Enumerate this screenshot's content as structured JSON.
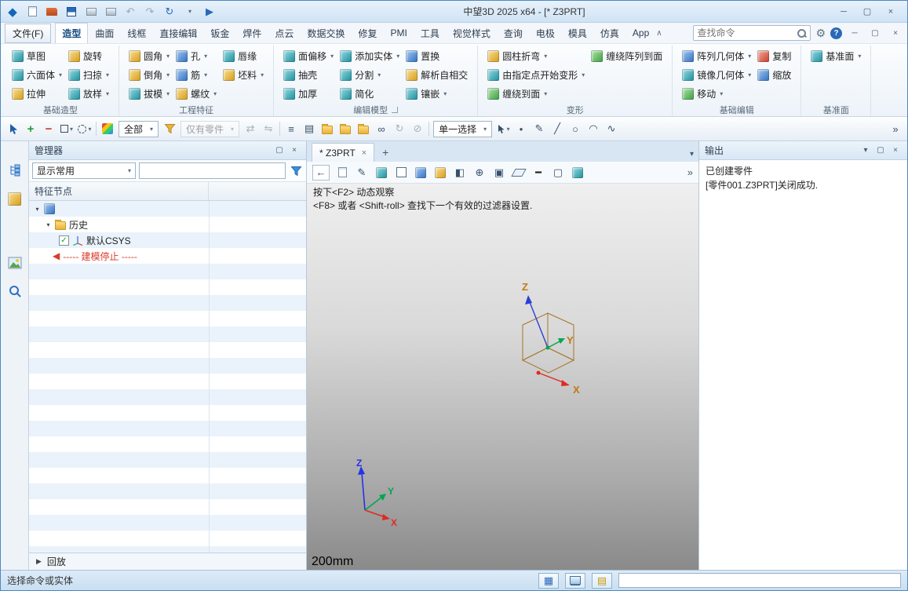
{
  "titlebar": {
    "title": "中望3D 2025 x64 - [* Z3PRT]"
  },
  "menubar": {
    "file_menu": "文件(F)",
    "tabs": [
      "造型",
      "曲面",
      "线框",
      "直接编辑",
      "钣金",
      "焊件",
      "点云",
      "数据交换",
      "修复",
      "PMI",
      "工具",
      "视觉样式",
      "查询",
      "电极",
      "模具",
      "仿真",
      "App"
    ],
    "active_tab": "造型",
    "search_placeholder": "查找命令"
  },
  "ribbon": {
    "groups": [
      {
        "label": "基础造型",
        "buttons": [
          "草图",
          "六面体",
          "拉伸",
          "旋转",
          "扫掠",
          "放样"
        ]
      },
      {
        "label": "工程特征",
        "buttons": [
          "圆角",
          "倒角",
          "拔模",
          "孔",
          "筋",
          "螺纹",
          "唇缘",
          "坯料"
        ]
      },
      {
        "label": "编辑模型",
        "buttons": [
          "面偏移",
          "抽壳",
          "加厚",
          "添加实体",
          "分割",
          "简化",
          "置换",
          "解析自相交",
          "镶嵌"
        ]
      },
      {
        "label": "变形",
        "buttons": [
          "圆柱折弯",
          "由指定点开始变形",
          "缠绕到面",
          "缠绕阵列到面"
        ]
      },
      {
        "label": "基础编辑",
        "buttons": [
          "阵列几何体",
          "镜像几何体",
          "移动",
          "复制",
          "缩放"
        ]
      },
      {
        "label": "基准面",
        "buttons": [
          "基准面"
        ]
      }
    ]
  },
  "selection_toolbar": {
    "filter_all": "全部",
    "entity_filter": "仅有零件",
    "pick_mode": "单一选择"
  },
  "manager": {
    "title": "管理器",
    "show_mode": "显示常用",
    "column_header": "特征节点",
    "nodes": {
      "history_folder": "历史",
      "default_csys": "默认CSYS",
      "stop_marker": "----- 建模停止 -----"
    },
    "replay": "回放"
  },
  "document": {
    "tab_label": "* Z3PRT"
  },
  "canvas": {
    "hint_line1": "按下<F2> 动态观察",
    "hint_line2": "<F8> 或者 <Shift-roll> 查找下一个有效的过滤器设置.",
    "scale_label": "200mm",
    "axis_labels": {
      "x": "X",
      "y": "Y",
      "z": "Z"
    }
  },
  "output": {
    "title": "输出",
    "lines": [
      "已创建零件",
      "[零件001.Z3PRT]关闭成功."
    ]
  },
  "statusbar": {
    "message": "选择命令或实体"
  },
  "icons": {
    "logo": "◆",
    "dropdown": "▾",
    "overflow": "»",
    "close": "×",
    "minimize": "─",
    "maximize": "▢",
    "undo": "↶",
    "redo": "↷",
    "regen": "↻",
    "play": "▶",
    "gear": "⚙",
    "help": "?",
    "plus": "+",
    "minus": "−",
    "check": "✓",
    "caret_down": "▾",
    "caret_right": "▶",
    "stop_arrow": "◀",
    "collapse": "∧",
    "pencil": "✎",
    "back": "←",
    "swap": "⇄",
    "invert": "⇋",
    "list": "≡",
    "sheet": "▤",
    "link": "∞",
    "refresh": "↻",
    "clear": "⊘",
    "line": "╱",
    "circle": "○",
    "arc": "◠",
    "spline": "∿",
    "dot": "●",
    "section": "◧",
    "target": "⊕",
    "frame": "▣",
    "bar": "━",
    "grid": "▦"
  },
  "colors": {
    "accent_blue": "#2e7cc0",
    "stop_red": "#d93a2b",
    "axis_x_red": "#e02a20",
    "axis_y_green": "#00a651",
    "axis_z_blue": "#2b3fd6",
    "csys_tan": "#a5752c"
  }
}
